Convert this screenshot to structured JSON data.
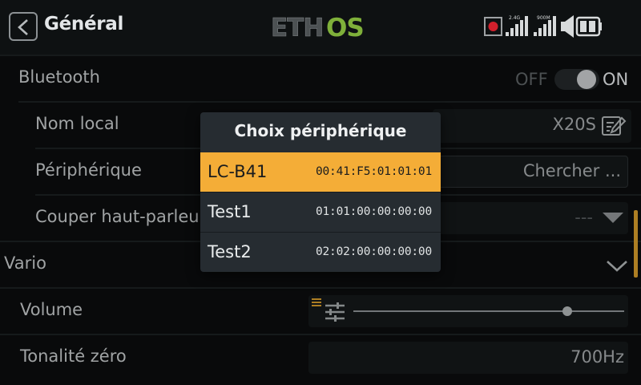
{
  "header": {
    "title": "Général",
    "brand": "ETHOS",
    "signal_labels": {
      "band_a": "2.4G",
      "band_b": "900M"
    },
    "accent": "#f4ad37"
  },
  "settings": {
    "bluetooth": {
      "label": "Bluetooth",
      "off_label": "OFF",
      "on_label": "ON",
      "state": "on"
    },
    "local_name": {
      "label": "Nom local",
      "value": "X20S"
    },
    "peripheral": {
      "label": "Périphérique",
      "value": "Chercher ..."
    },
    "mute_speaker": {
      "label": "Couper haut-parleur",
      "value": "---"
    },
    "vario": {
      "label": "Vario"
    },
    "volume": {
      "label": "Volume",
      "level": 0.79
    },
    "zero_tone": {
      "label": "Tonalité zéro",
      "value": "700Hz"
    }
  },
  "popup": {
    "title": "Choix périphérique",
    "items": [
      {
        "name": "LC-B41",
        "address": "00:41:F5:01:01:01",
        "selected": true
      },
      {
        "name": "Test1",
        "address": "01:01:00:00:00:00",
        "selected": false
      },
      {
        "name": "Test2",
        "address": "02:02:00:00:00:00",
        "selected": false
      }
    ]
  }
}
